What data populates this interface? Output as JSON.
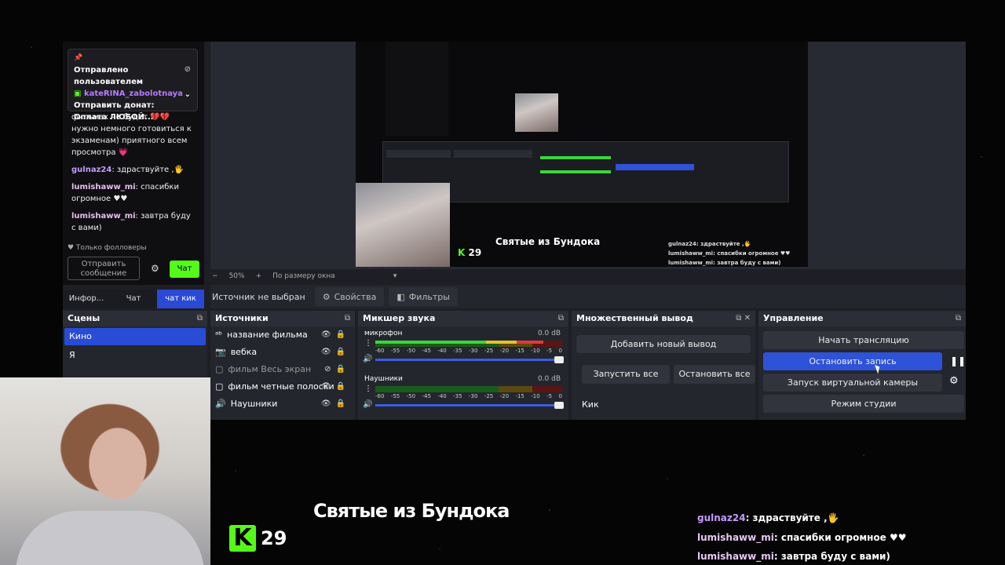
{
  "chat": {
    "pinned_header": "Отправлено пользователем",
    "pinned_user": "kateRINA_zabolotnaya",
    "pinned_text1": "Отправить донат:",
    "pinned_text2": "Оплата ЛЮБОЙ...",
    "messages": [
      {
        "user": "",
        "text": "фильмах не будет 💔💔 нужно немного готовиться к экзаменам) приятного всем просмотра 💗"
      },
      {
        "user": "gulnaz24",
        "text": ": здраствуйте ,🖐"
      },
      {
        "user": "lumishaww_mi",
        "text": ": спасибки огромное ♥♥"
      },
      {
        "user": "lumishaww_mi",
        "text": ": завтра буду с вами)"
      }
    ],
    "followers_only": "♥ Только фолловеры",
    "send_placeholder": "Отправить сообщение",
    "chat_button": "Чат",
    "tabs": [
      "Инфор...",
      "Чат",
      "чат кик"
    ]
  },
  "preview": {
    "zoom": "50%",
    "fit_label": "По размеру окна",
    "title": "Святые из Бундока",
    "kick_count": "29",
    "mini_chat": [
      "gulnaz24: здраствуйте ,🖐",
      "lumishaww_mi: спасибки огромное ♥♥",
      "lumishaww_mi: завтра буду с вами)"
    ]
  },
  "source_bar": {
    "no_source": "Источник не выбран",
    "properties": "Свойства",
    "filters": "Фильтры"
  },
  "scenes": {
    "title": "Сцены",
    "items": [
      "Кино",
      "Я"
    ]
  },
  "sources": {
    "title": "Источники",
    "items": [
      "название фильма",
      "вебка",
      "фильм Весь экран",
      "фильм четные полоски",
      "Наушники"
    ]
  },
  "mixer": {
    "title": "Микшер звука",
    "tracks": [
      {
        "name": "микрофон",
        "db": "0.0 dB",
        "level": 0.9
      },
      {
        "name": "Наушники",
        "db": "0.0 dB",
        "level": 0.0
      }
    ],
    "scale": [
      "-60",
      "-55",
      "-50",
      "-45",
      "-40",
      "-35",
      "-30",
      "-25",
      "-20",
      "-15",
      "-10",
      "-5",
      "0"
    ]
  },
  "multi_output": {
    "title": "Множественный вывод",
    "add": "Добавить новый вывод",
    "start_all": "Запустить все",
    "stop_all": "Остановить все",
    "kick": "Кик"
  },
  "controls": {
    "title": "Управление",
    "start_stream": "Начать трансляцию",
    "stop_record": "Остановить запись",
    "virtual_cam": "Запуск виртуальной камеры",
    "studio_mode": "Режим студии"
  },
  "overlay": {
    "title": "Святые из Бундока",
    "kick_count": "29",
    "chat": [
      {
        "user": "gulnaz24",
        "text": ": здраствуйте ,🖐"
      },
      {
        "user": "lumishaww_mi",
        "text": ": спасибки огромное ♥♥"
      },
      {
        "user": "lumishaww_mi",
        "text": ": завтра буду с вами)"
      }
    ]
  }
}
